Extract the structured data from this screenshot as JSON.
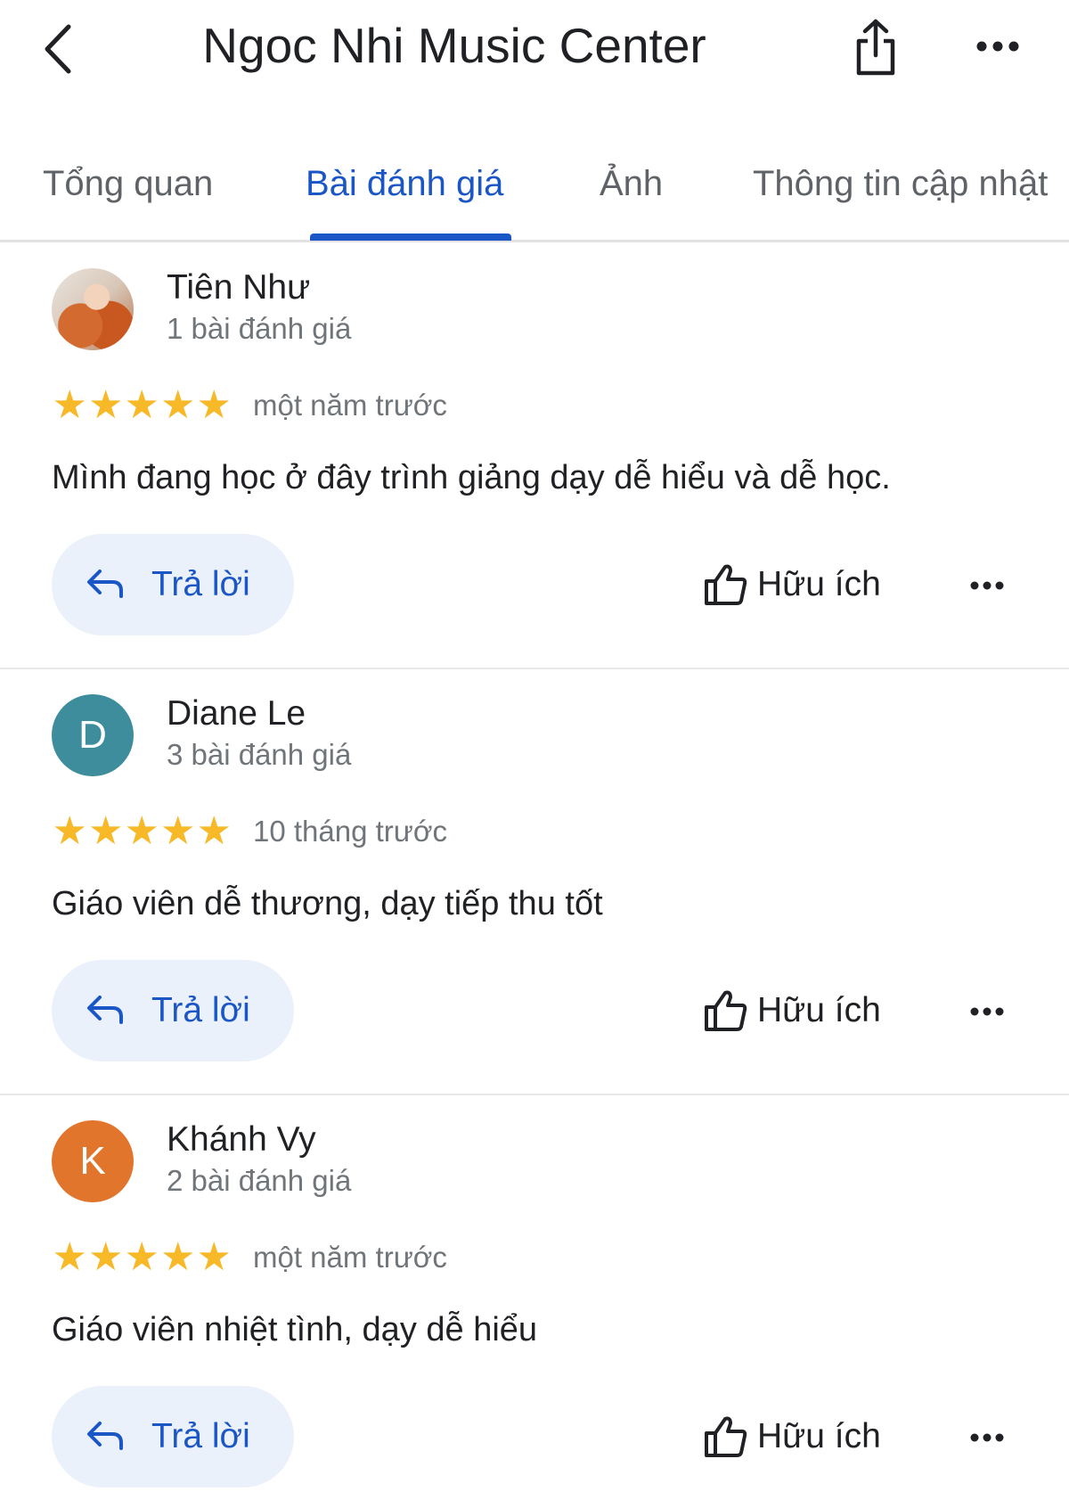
{
  "header": {
    "title": "Ngoc Nhi Music Center"
  },
  "tabs": [
    {
      "label": "Tổng quan",
      "active": false
    },
    {
      "label": "Bài đánh giá",
      "active": true
    },
    {
      "label": "Ảnh",
      "active": false
    },
    {
      "label": "Thông tin cập nhật",
      "active": false
    }
  ],
  "colors": {
    "accent": "#1a56c5",
    "star": "#f7b928",
    "reply_background": "#eaf1fb",
    "avatar_d": "#3d8d9c",
    "avatar_k": "#e2752c"
  },
  "icons": [
    "back-arrow-icon",
    "share-icon",
    "more-icon",
    "star-icon",
    "reply-icon",
    "thumbs-up-icon"
  ],
  "reviews": [
    {
      "name": "Tiên Như",
      "review_count": "1 bài đánh giá",
      "rating": 5,
      "time": "một năm trước",
      "text": "Mình đang học ở đây trình giảng dạy dễ hiểu và dễ học.",
      "reply_label": "Trả lời",
      "helpful_label": "Hữu ích",
      "avatar_initial": ""
    },
    {
      "name": "Diane Le",
      "review_count": "3 bài đánh giá",
      "rating": 5,
      "time": "10 tháng trước",
      "text": "Giáo viên dễ thương, dạy tiếp thu tốt",
      "reply_label": "Trả lời",
      "helpful_label": "Hữu ích",
      "avatar_initial": "D"
    },
    {
      "name": "Khánh Vy",
      "review_count": "2 bài đánh giá",
      "rating": 5,
      "time": "một năm trước",
      "text": "Giáo viên nhiệt tình, dạy dễ hiểu",
      "reply_label": "Trả lời",
      "helpful_label": "Hữu ích",
      "avatar_initial": "K"
    }
  ]
}
